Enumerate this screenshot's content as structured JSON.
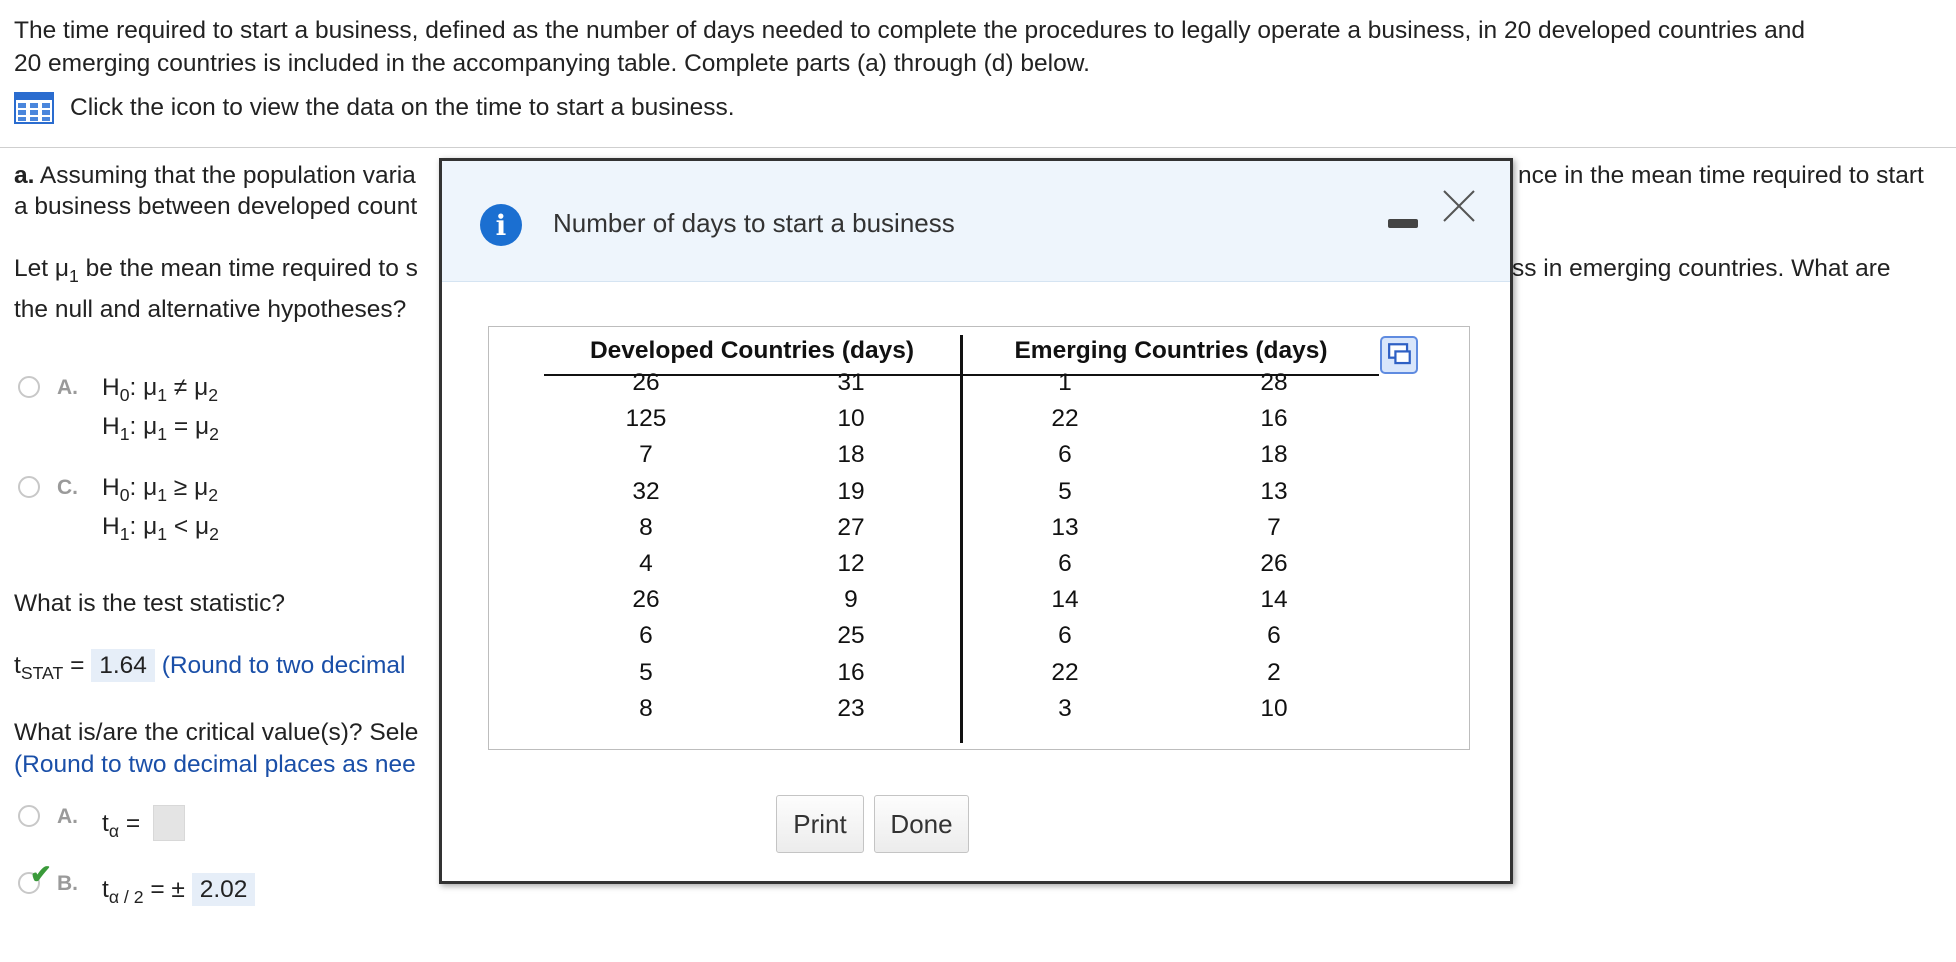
{
  "question": {
    "intro_line1": "The time required to start a business, defined as the number of days needed to complete the procedures to legally operate a business, in 20 developed countries and",
    "intro_line2": "20 emerging countries is included in the accompanying table. Complete parts (a) through (d) below.",
    "view_data_text": "Click the icon to view the data on the time to start a business."
  },
  "part_a": {
    "label": "a.",
    "text_left": "Assuming that the population varia",
    "text_right": "nce in the mean time required to start",
    "line2_left": "a business between developed count",
    "let_prefix": "Let μ",
    "let_sub": "1",
    "let_left": "be the mean time required to s",
    "let_right": "ss in emerging countries. What are",
    "hyp_question": "the null and alternative hypotheses?",
    "options": [
      {
        "letter": "A.",
        "h0_main": "μ",
        "h0_sub1": "1",
        "h0_op": "≠",
        "h0_sub2": "2",
        "h1_op": "=",
        "h1_sub2": "2"
      },
      {
        "letter": "C.",
        "h0_main": "μ",
        "h0_sub1": "1",
        "h0_op": "≥",
        "h0_sub2": "2",
        "h1_op": "<",
        "h1_sub2": "2"
      }
    ],
    "h_letter": "H",
    "h0_sub": "0",
    "h1_sub": "1",
    "mu": "μ",
    "mu_sub1": "1",
    "colon": ":",
    "test_stat_question": "What is the test statistic?",
    "tstat_t": "t",
    "tstat_sub": "STAT",
    "equals": "=",
    "tstat_value": "1.64",
    "tstat_hint": "(Round to two decimal",
    "critical_question": "What is/are the critical value(s)? Sele",
    "critical_hint": "(Round to two decimal places as nee",
    "crit_a_letter": "A.",
    "crit_a_t": "t",
    "crit_a_sub": "α",
    "crit_b_letter": "B.",
    "crit_b_t": "t",
    "crit_b_sub": "α / 2",
    "crit_b_pm": "= ±",
    "crit_b_value": "2.02",
    "check_glyph": "✔"
  },
  "dialog": {
    "title": "Number of days to start a business",
    "info_glyph": "i",
    "col_dev": "Developed Countries (days)",
    "col_emg": "Emerging Countries (days)",
    "dev1": [
      "26",
      "125",
      "7",
      "32",
      "8",
      "4",
      "26",
      "6",
      "5",
      "8"
    ],
    "dev2": [
      "31",
      "10",
      "18",
      "19",
      "27",
      "12",
      "9",
      "25",
      "16",
      "23"
    ],
    "emg1": [
      "1",
      "22",
      "6",
      "5",
      "13",
      "6",
      "14",
      "6",
      "22",
      "3"
    ],
    "emg2": [
      "28",
      "16",
      "18",
      "13",
      "7",
      "26",
      "14",
      "6",
      "2",
      "10"
    ],
    "print_label": "Print",
    "done_label": "Done"
  }
}
